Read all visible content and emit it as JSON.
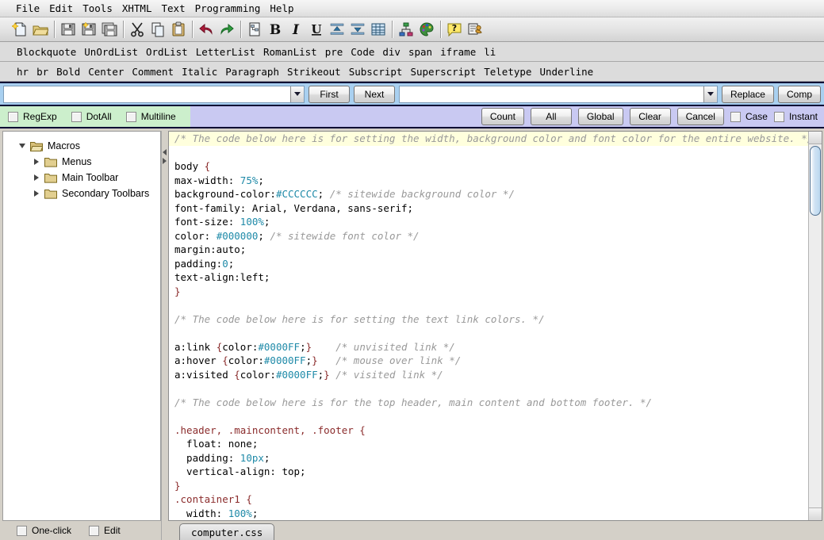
{
  "menubar": {
    "items": [
      {
        "label": "File"
      },
      {
        "label": "Edit"
      },
      {
        "label": "Tools"
      },
      {
        "label": "XHTML"
      },
      {
        "label": "Text"
      },
      {
        "label": "Programming"
      },
      {
        "label": "Help"
      }
    ]
  },
  "toolbar": {
    "groups": [
      {
        "buttons": [
          {
            "icon": "new-file-icon",
            "title": "New"
          },
          {
            "icon": "open-folder-icon",
            "title": "Open"
          }
        ]
      },
      {
        "buttons": [
          {
            "icon": "save-icon",
            "title": "Save"
          },
          {
            "icon": "save-as-icon",
            "title": "Save As"
          },
          {
            "icon": "save-all-icon",
            "title": "Save All"
          }
        ]
      },
      {
        "buttons": [
          {
            "icon": "cut-scissors-icon",
            "title": "Cut"
          },
          {
            "icon": "copy-icon",
            "title": "Copy"
          },
          {
            "icon": "paste-clipboard-icon",
            "title": "Paste"
          }
        ]
      },
      {
        "buttons": [
          {
            "icon": "undo-arrow-icon",
            "title": "Undo"
          },
          {
            "icon": "redo-arrow-icon",
            "title": "Redo"
          }
        ]
      },
      {
        "buttons": [
          {
            "icon": "document-properties-icon",
            "title": "Document"
          },
          {
            "icon": "bold-icon",
            "title": "Bold"
          },
          {
            "icon": "italic-icon",
            "title": "Italic"
          },
          {
            "icon": "underline-icon",
            "title": "Underline"
          },
          {
            "icon": "indent-decrease-icon",
            "title": "Outdent"
          },
          {
            "icon": "indent-increase-icon",
            "title": "Indent"
          },
          {
            "icon": "table-icon",
            "title": "Table"
          }
        ]
      },
      {
        "buttons": [
          {
            "icon": "sitemap-icon",
            "title": "Site Map"
          },
          {
            "icon": "color-palette-icon",
            "title": "Colors"
          }
        ]
      },
      {
        "buttons": [
          {
            "icon": "help-question-icon",
            "title": "Help"
          },
          {
            "icon": "macro-icon",
            "title": "Macros"
          }
        ]
      }
    ]
  },
  "tagrow1": {
    "items": [
      {
        "label": "Blockquote"
      },
      {
        "label": "UnOrdList"
      },
      {
        "label": "OrdList"
      },
      {
        "label": "LetterList"
      },
      {
        "label": "RomanList"
      },
      {
        "label": "pre"
      },
      {
        "label": "Code"
      },
      {
        "label": "div"
      },
      {
        "label": "span"
      },
      {
        "label": "iframe"
      },
      {
        "label": "li"
      }
    ]
  },
  "tagrow2": {
    "items": [
      {
        "label": "hr"
      },
      {
        "label": "br"
      },
      {
        "label": "Bold"
      },
      {
        "label": "Center"
      },
      {
        "label": "Comment"
      },
      {
        "label": "Italic"
      },
      {
        "label": "Paragraph"
      },
      {
        "label": "Strikeout"
      },
      {
        "label": "Subscript"
      },
      {
        "label": "Superscript"
      },
      {
        "label": "Teletype"
      },
      {
        "label": "Underline"
      }
    ]
  },
  "findbar": {
    "search_value": "",
    "search_placeholder": "",
    "replace_value": "",
    "replace_placeholder": "",
    "first_label": "First",
    "next_label": "Next",
    "replace_label": "Replace",
    "comp_label": "Comp"
  },
  "optionsbar": {
    "left_checkboxes": [
      {
        "label": "RegExp",
        "checked": false
      },
      {
        "label": "DotAll",
        "checked": false
      },
      {
        "label": "Multiline",
        "checked": false
      }
    ],
    "buttons": [
      {
        "label": "Count"
      },
      {
        "label": "All"
      },
      {
        "label": "Global"
      },
      {
        "label": "Clear"
      },
      {
        "label": "Cancel"
      }
    ],
    "right_checkboxes": [
      {
        "label": "Case",
        "checked": false
      },
      {
        "label": "Instant",
        "checked": false
      }
    ]
  },
  "sidebar": {
    "tree": [
      {
        "label": "Macros",
        "depth": 0,
        "state": "open"
      },
      {
        "label": "Menus",
        "depth": 1,
        "state": "closed"
      },
      {
        "label": "Main Toolbar",
        "depth": 1,
        "state": "closed"
      },
      {
        "label": "Secondary Toolbars",
        "depth": 1,
        "state": "closed"
      }
    ],
    "bottom_checkboxes": [
      {
        "label": "One-click",
        "checked": false
      },
      {
        "label": "Edit",
        "checked": false
      }
    ]
  },
  "editor": {
    "tab_label": "computer.css",
    "lines": [
      {
        "highlight": true,
        "tokens": [
          {
            "t": "/* The code below here is for setting the width, background color and font color for the entire website. */",
            "c": "cm"
          }
        ]
      },
      {
        "tokens": []
      },
      {
        "tokens": [
          {
            "t": "body ",
            "c": ""
          },
          {
            "t": "{",
            "c": "brc"
          }
        ]
      },
      {
        "tokens": [
          {
            "t": "max-width: ",
            "c": ""
          },
          {
            "t": "75%",
            "c": "num"
          },
          {
            "t": ";",
            "c": ""
          }
        ]
      },
      {
        "tokens": [
          {
            "t": "background-color:",
            "c": ""
          },
          {
            "t": "#CCCCCC",
            "c": "hex"
          },
          {
            "t": "; ",
            "c": ""
          },
          {
            "t": "/* sitewide background color */",
            "c": "cm"
          }
        ]
      },
      {
        "tokens": [
          {
            "t": "font-family: Arial, Verdana, sans-serif;",
            "c": ""
          }
        ]
      },
      {
        "tokens": [
          {
            "t": "font-size: ",
            "c": ""
          },
          {
            "t": "100%",
            "c": "num"
          },
          {
            "t": ";",
            "c": ""
          }
        ]
      },
      {
        "tokens": [
          {
            "t": "color: ",
            "c": ""
          },
          {
            "t": "#000000",
            "c": "hex"
          },
          {
            "t": "; ",
            "c": ""
          },
          {
            "t": "/* sitewide font color */",
            "c": "cm"
          }
        ]
      },
      {
        "tokens": [
          {
            "t": "margin:auto;",
            "c": ""
          }
        ]
      },
      {
        "tokens": [
          {
            "t": "padding:",
            "c": ""
          },
          {
            "t": "0",
            "c": "num"
          },
          {
            "t": ";",
            "c": ""
          }
        ]
      },
      {
        "tokens": [
          {
            "t": "text-align:left;",
            "c": ""
          }
        ]
      },
      {
        "tokens": [
          {
            "t": "}",
            "c": "brc"
          }
        ]
      },
      {
        "tokens": []
      },
      {
        "tokens": [
          {
            "t": "/* The code below here is for setting the text link colors. */",
            "c": "cm"
          }
        ]
      },
      {
        "tokens": []
      },
      {
        "tokens": [
          {
            "t": "a:link ",
            "c": ""
          },
          {
            "t": "{",
            "c": "brc"
          },
          {
            "t": "color:",
            "c": ""
          },
          {
            "t": "#0000FF",
            "c": "hex"
          },
          {
            "t": ";",
            "c": ""
          },
          {
            "t": "}",
            "c": "brc"
          },
          {
            "t": "    ",
            "c": ""
          },
          {
            "t": "/* unvisited link */",
            "c": "cm"
          }
        ]
      },
      {
        "tokens": [
          {
            "t": "a:hover ",
            "c": ""
          },
          {
            "t": "{",
            "c": "brc"
          },
          {
            "t": "color:",
            "c": ""
          },
          {
            "t": "#0000FF",
            "c": "hex"
          },
          {
            "t": ";",
            "c": ""
          },
          {
            "t": "}",
            "c": "brc"
          },
          {
            "t": "   ",
            "c": ""
          },
          {
            "t": "/* mouse over link */",
            "c": "cm"
          }
        ]
      },
      {
        "tokens": [
          {
            "t": "a:visited ",
            "c": ""
          },
          {
            "t": "{",
            "c": "brc"
          },
          {
            "t": "color:",
            "c": ""
          },
          {
            "t": "#0000FF",
            "c": "hex"
          },
          {
            "t": ";",
            "c": ""
          },
          {
            "t": "}",
            "c": "brc"
          },
          {
            "t": " ",
            "c": ""
          },
          {
            "t": "/* visited link */",
            "c": "cm"
          }
        ]
      },
      {
        "tokens": []
      },
      {
        "tokens": [
          {
            "t": "/* The code below here is for the top header, main content and bottom footer. */",
            "c": "cm"
          }
        ]
      },
      {
        "tokens": []
      },
      {
        "tokens": [
          {
            "t": ".header, .maincontent, .footer ",
            "c": "sel"
          },
          {
            "t": "{",
            "c": "brc"
          }
        ]
      },
      {
        "tokens": [
          {
            "t": "  float: none;",
            "c": ""
          }
        ]
      },
      {
        "tokens": [
          {
            "t": "  padding: ",
            "c": ""
          },
          {
            "t": "10px",
            "c": "num"
          },
          {
            "t": ";",
            "c": ""
          }
        ]
      },
      {
        "tokens": [
          {
            "t": "  vertical-align: top;",
            "c": ""
          }
        ]
      },
      {
        "tokens": [
          {
            "t": "}",
            "c": "brc"
          }
        ]
      },
      {
        "tokens": [
          {
            "t": ".container1 ",
            "c": "sel"
          },
          {
            "t": "{",
            "c": "brc"
          }
        ]
      },
      {
        "tokens": [
          {
            "t": "  width: ",
            "c": ""
          },
          {
            "t": "100%",
            "c": "num"
          },
          {
            "t": ";",
            "c": ""
          }
        ]
      }
    ]
  },
  "colors": {
    "findbar_bg": "#a9d0f0",
    "options_left_bg": "#ccefcc",
    "options_right_bg": "#c9c9f2",
    "highlight_line_bg": "#ffffdd",
    "comment": "#999999",
    "number": "#1f8aa8",
    "selector": "#8b2c2c",
    "window_bg": "#d4d0c8"
  }
}
